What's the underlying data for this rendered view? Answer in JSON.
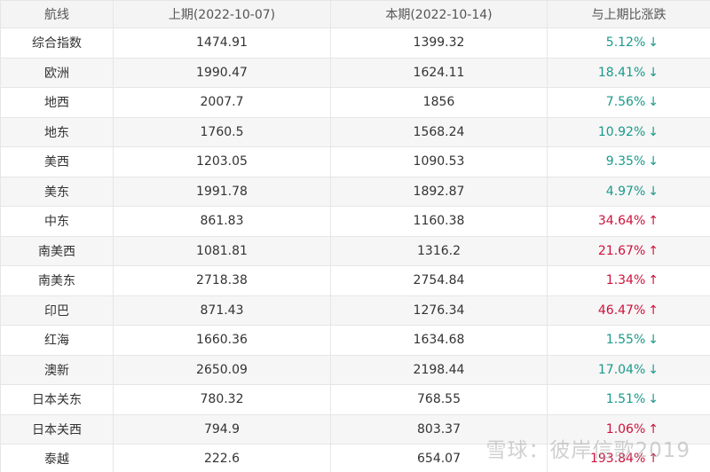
{
  "table": {
    "headers": [
      "航线",
      "上期(2022-10-07)",
      "本期(2022-10-14)",
      "与上期比涨跌"
    ],
    "rows": [
      {
        "route": "综合指数",
        "prev": "1474.91",
        "curr": "1399.32",
        "change": "5.12%",
        "direction": "down",
        "arrow": "↓"
      },
      {
        "route": "欧洲",
        "prev": "1990.47",
        "curr": "1624.11",
        "change": "18.41%",
        "direction": "down",
        "arrow": "↓"
      },
      {
        "route": "地西",
        "prev": "2007.7",
        "curr": "1856",
        "change": "7.56%",
        "direction": "down",
        "arrow": "↓"
      },
      {
        "route": "地东",
        "prev": "1760.5",
        "curr": "1568.24",
        "change": "10.92%",
        "direction": "down",
        "arrow": "↓"
      },
      {
        "route": "美西",
        "prev": "1203.05",
        "curr": "1090.53",
        "change": "9.35%",
        "direction": "down",
        "arrow": "↓"
      },
      {
        "route": "美东",
        "prev": "1991.78",
        "curr": "1892.87",
        "change": "4.97%",
        "direction": "down",
        "arrow": "↓"
      },
      {
        "route": "中东",
        "prev": "861.83",
        "curr": "1160.38",
        "change": "34.64%",
        "direction": "up",
        "arrow": "↑"
      },
      {
        "route": "南美西",
        "prev": "1081.81",
        "curr": "1316.2",
        "change": "21.67%",
        "direction": "up",
        "arrow": "↑"
      },
      {
        "route": "南美东",
        "prev": "2718.38",
        "curr": "2754.84",
        "change": "1.34%",
        "direction": "up",
        "arrow": "↑"
      },
      {
        "route": "印巴",
        "prev": "871.43",
        "curr": "1276.34",
        "change": "46.47%",
        "direction": "up",
        "arrow": "↑"
      },
      {
        "route": "红海",
        "prev": "1660.36",
        "curr": "1634.68",
        "change": "1.55%",
        "direction": "down",
        "arrow": "↓"
      },
      {
        "route": "澳新",
        "prev": "2650.09",
        "curr": "2198.44",
        "change": "17.04%",
        "direction": "down",
        "arrow": "↓"
      },
      {
        "route": "日本关东",
        "prev": "780.32",
        "curr": "768.55",
        "change": "1.51%",
        "direction": "down",
        "arrow": "↓"
      },
      {
        "route": "日本关西",
        "prev": "794.9",
        "curr": "803.37",
        "change": "1.06%",
        "direction": "up",
        "arrow": "↑"
      },
      {
        "route": "泰越",
        "prev": "222.6",
        "curr": "654.07",
        "change": "193.84%",
        "direction": "up",
        "arrow": "↑"
      }
    ]
  },
  "watermark": "雪球：彼岸信歌2019",
  "colors": {
    "down": "#1a9a8a",
    "up": "#d0103a"
  }
}
